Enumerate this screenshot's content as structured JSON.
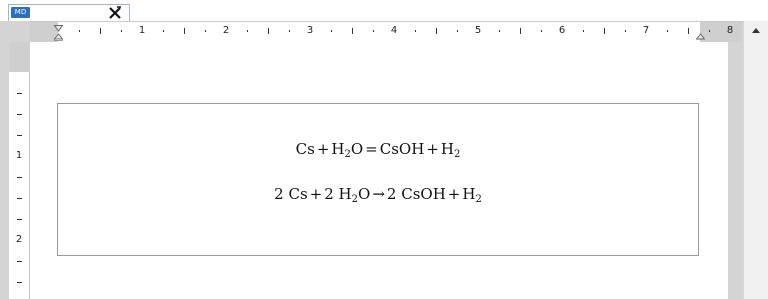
{
  "tab": {
    "app_icon_label": "MD",
    "close_icon": "close-icon"
  },
  "ruler": {
    "horizontal_numbers": [
      "1",
      "2",
      "3",
      "4",
      "5",
      "6",
      "7",
      "8"
    ],
    "vertical_numbers": [
      "1",
      "2"
    ]
  },
  "equations": [
    {
      "parts": [
        "Cs",
        "+",
        "H",
        "2",
        "O",
        "=",
        "CsOH",
        "+",
        "H",
        "2"
      ]
    },
    {
      "parts": [
        "2 Cs",
        "+",
        "2 H",
        "2",
        "O",
        "→",
        "2 CsOH",
        "+",
        "H",
        "2"
      ]
    }
  ],
  "colors": {
    "app_icon": "#2b6fc1",
    "ruler_margin": "#cfcfcf",
    "background": "#d4d4d4",
    "box_border": "#9a9a9a"
  }
}
